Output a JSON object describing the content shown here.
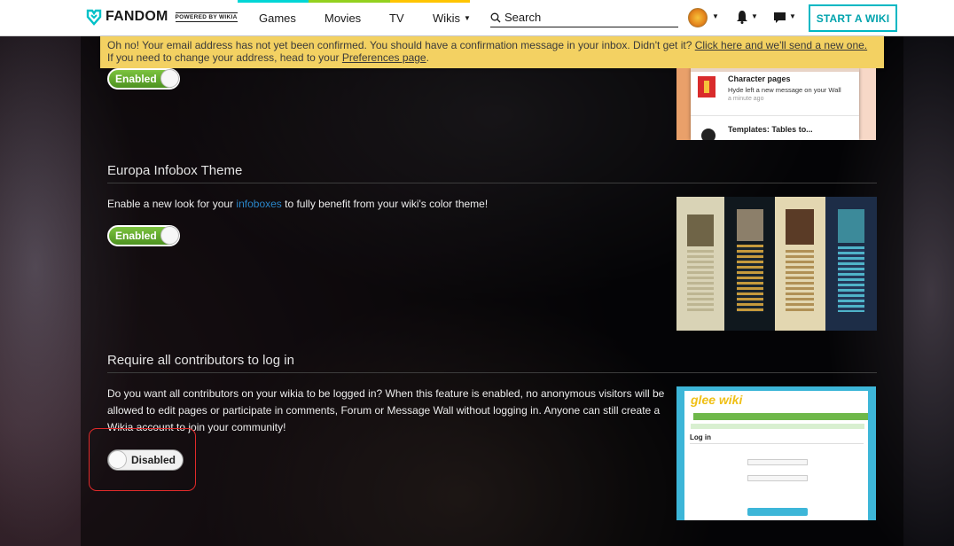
{
  "topbar": {
    "brand": "FANDOM",
    "badge": "POWERED BY WIKIA",
    "nav": [
      "Games",
      "Movies",
      "TV",
      "Wikis"
    ],
    "search_placeholder": "Search",
    "start_wiki": "START A WIKI"
  },
  "banner": {
    "line1": "Oh no! Your email address has not yet been confirmed. You should have a confirmation message in your inbox. Didn't get it?",
    "line1_link": "Click here and we'll send a new one.",
    "line2": "If you need to change your address, head to your",
    "line2_link": "Preferences page",
    "line2_end": "."
  },
  "sections": [
    {
      "toggle": "Enabled"
    },
    {
      "title": "Europa Infobox Theme",
      "desc_before": "Enable a new look for your ",
      "desc_link": "infoboxes",
      "desc_after": " to fully benefit from your wiki's color theme!",
      "toggle": "Enabled"
    },
    {
      "title": "Require all contributors to log in",
      "desc": "Do you want all contributors on your wikia to be logged in? When this feature is enabled, no anonymous visitors will be allowed to edit pages or participate in comments, Forum or Message Wall without logging in. Anyone can still create a Wikia account to join your community!",
      "toggle": "Disabled"
    }
  ],
  "thumb1": {
    "items": [
      {
        "title": "Character pages",
        "sub": "Hyde left a new message on your Wall",
        "time": "a minute ago"
      },
      {
        "title": "Templates: Tables to..."
      }
    ]
  },
  "thumb3": {
    "logo": "glee wiki",
    "login": "Log in"
  }
}
